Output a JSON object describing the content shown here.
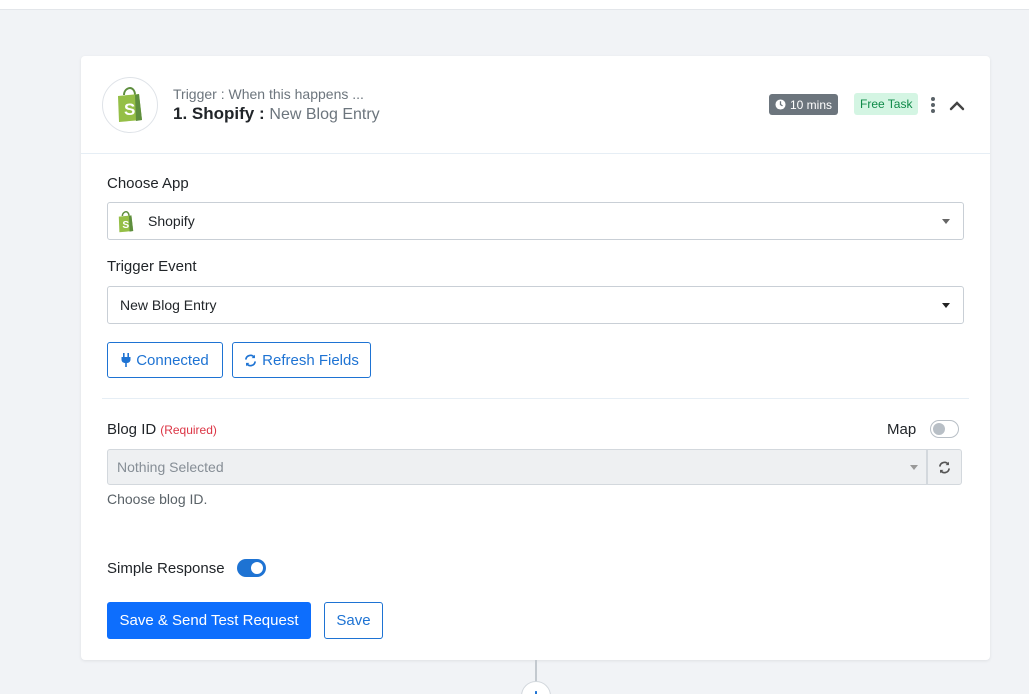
{
  "header": {
    "trigger_subtitle": "Trigger : When this happens ...",
    "step_number": "1.",
    "app_name": "Shopify",
    "separator": ":",
    "event_name": "New Blog Entry",
    "time_badge": "10 mins",
    "free_badge": "Free Task"
  },
  "form": {
    "choose_app_label": "Choose App",
    "choose_app_value": "Shopify",
    "trigger_event_label": "Trigger Event",
    "trigger_event_value": "New Blog Entry",
    "connected_label": "Connected",
    "refresh_fields_label": "Refresh Fields",
    "blog_id_label": "Blog ID",
    "required_label": "(Required)",
    "map_label": "Map",
    "blog_id_placeholder": "Nothing Selected",
    "blog_id_help": "Choose blog ID.",
    "simple_response_label": "Simple Response",
    "map_toggle_on": false,
    "simple_response_on": true
  },
  "actions": {
    "save_and_test_label": "Save & Send Test Request",
    "save_label": "Save"
  },
  "connector": {
    "add_symbol": "+"
  },
  "colors": {
    "primary": "#0d6efd",
    "shopify_green": "#95bf47",
    "free_badge_bg": "#d4f5e3"
  },
  "icons": [
    "shopify-logo",
    "clock-icon",
    "kebab-menu-icon",
    "chevron-up-icon",
    "plug-icon",
    "refresh-icon",
    "caret-down-icon"
  ]
}
